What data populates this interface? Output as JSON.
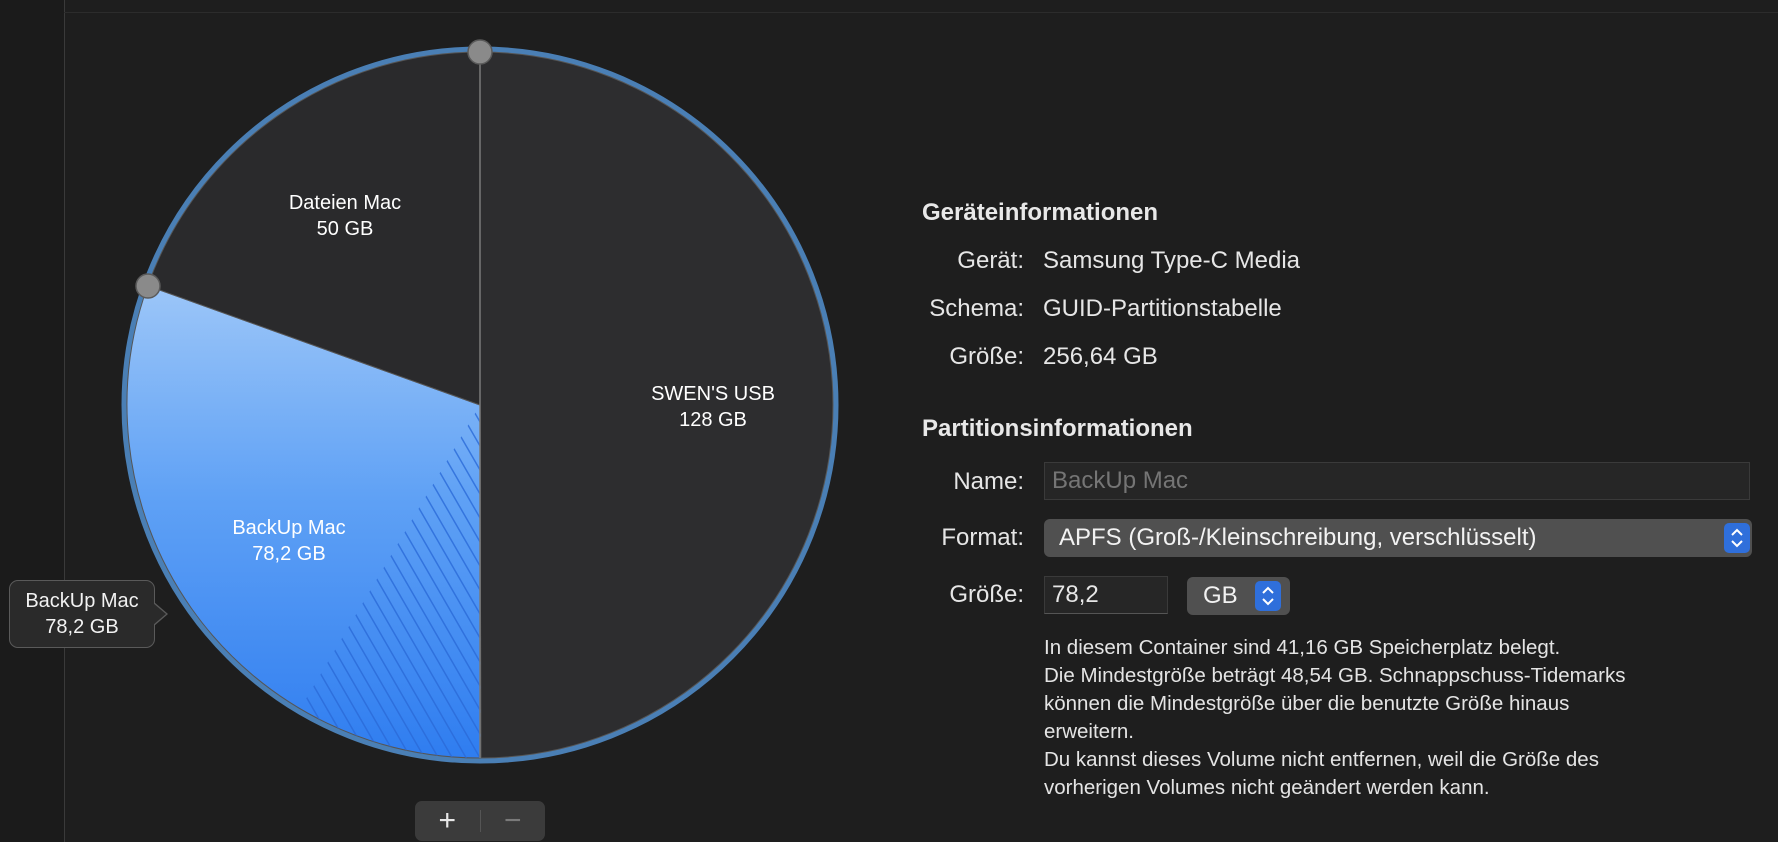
{
  "partition_map": {
    "slices": [
      {
        "name": "SWEN'S USB",
        "size": "128 GB",
        "size_gb": 128,
        "color": "#2d2d2f"
      },
      {
        "name": "BackUp Mac",
        "size": "78,2 GB",
        "size_gb": 78.2,
        "color": "#4c95f5",
        "selected": true
      },
      {
        "name": "Dateien Mac",
        "size": "50 GB",
        "size_gb": 50,
        "color": "#2a2a2c"
      }
    ],
    "ring_color": "#4a7fb5"
  },
  "tooltip": {
    "name": "BackUp Mac",
    "size": "78,2 GB"
  },
  "controls": {
    "add_label": "+",
    "remove_label": "−"
  },
  "device_info": {
    "title": "Geräteinformationen",
    "rows": [
      {
        "label": "Gerät:",
        "value": "Samsung Type-C Media"
      },
      {
        "label": "Schema:",
        "value": "GUID-Partitionstabelle"
      },
      {
        "label": "Größe:",
        "value": "256,64 GB"
      }
    ]
  },
  "partition_info": {
    "title": "Partitionsinformationen",
    "name_label": "Name:",
    "name_placeholder": "BackUp Mac",
    "format_label": "Format:",
    "format_value": "APFS (Groß-/Kleinschreibung, verschlüsselt)",
    "size_label": "Größe:",
    "size_value": "78,2",
    "unit_value": "GB",
    "notes": [
      "In diesem Container sind 41,16 GB Speicherplatz belegt.",
      "Die Mindestgröße beträgt 48,54 GB. Schnappschuss-Tidemarks",
      "können die Mindestgröße über die benutzte Größe hinaus",
      "erweitern.",
      "Du kannst dieses Volume nicht entfernen, weil die Größe des",
      "vorherigen Volumes nicht geändert werden kann."
    ]
  }
}
